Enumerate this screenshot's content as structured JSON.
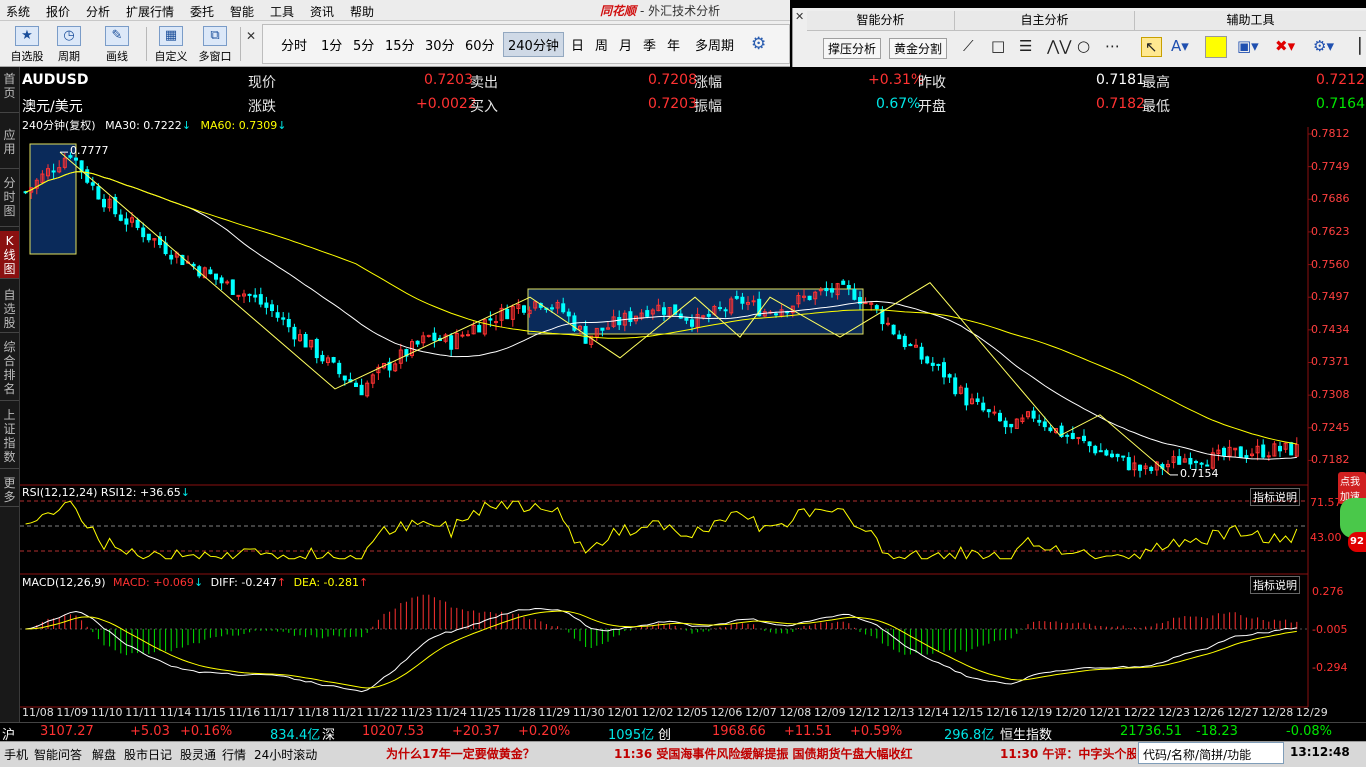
{
  "menu": [
    "系统",
    "报价",
    "分析",
    "扩展行情",
    "委托",
    "智能",
    "工具",
    "资讯",
    "帮助"
  ],
  "app_title": "同花顺",
  "app_subtitle": "- 外汇技术分析",
  "toolbar": [
    {
      "label": "自选股",
      "icon": "star-icon"
    },
    {
      "label": "周期",
      "icon": "clock-icon"
    },
    {
      "label": "画线",
      "icon": "pencil-icon"
    },
    {
      "label": "自定义",
      "icon": "grid-icon"
    },
    {
      "label": "多窗口",
      "icon": "windows-icon"
    }
  ],
  "periods": [
    "分时",
    "1分",
    "5分",
    "15分",
    "30分",
    "60分",
    "240分钟",
    "日",
    "周",
    "月",
    "季",
    "年",
    "多周期"
  ],
  "active_period": "240分钟",
  "tool_panel": {
    "headers": [
      "智能分析",
      "自主分析",
      "辅助工具"
    ],
    "buttons": [
      "撑压分析",
      "黄金分割"
    ]
  },
  "left_nav": [
    "首页",
    "应用",
    "分时图",
    "K线图",
    "自选股",
    "综合排名",
    "上证指数",
    "更多"
  ],
  "quote": {
    "symbol": "AUDUSD",
    "name": "澳元/美元",
    "row1": [
      {
        "label": "现价",
        "value": "0.7203",
        "color": "red"
      },
      {
        "label": "卖出",
        "value": "0.7208",
        "color": "red"
      },
      {
        "label": "涨幅",
        "value": "+0.31%",
        "color": "red"
      },
      {
        "label": "昨收",
        "value": "0.7181",
        "color": "white"
      },
      {
        "label": "最高",
        "value": "0.7212",
        "color": "red"
      }
    ],
    "row2": [
      {
        "label": "涨跌",
        "value": "+0.0022",
        "color": "red"
      },
      {
        "label": "买入",
        "value": "0.7203",
        "color": "red"
      },
      {
        "label": "振幅",
        "value": "0.67%",
        "color": "cyan"
      },
      {
        "label": "开盘",
        "value": "0.7182",
        "color": "red"
      },
      {
        "label": "最低",
        "value": "0.7164",
        "color": "green"
      }
    ]
  },
  "main_legend": {
    "period": "240分钟(复权)",
    "ma30": "MA30: 0.7222",
    "ma60": "MA60: 0.7309"
  },
  "rsi_legend": "RSI(12,12,24)  RSI12: +36.65",
  "macd_legend": {
    "name": "MACD(12,26,9)",
    "macd": "MACD: +0.069",
    "diff": "DIFF: -0.247",
    "dea": "DEA: -0.281"
  },
  "indicator_help": "指标说明",
  "click_badge": "点我加速",
  "badge_number": "92",
  "chart_data": {
    "type": "candlestick",
    "price_axis": [
      "0.7812",
      "0.7749",
      "0.7686",
      "0.7623",
      "0.7560",
      "0.7497",
      "0.7434",
      "0.7371",
      "0.7308",
      "0.7245",
      "0.7182"
    ],
    "ylim": [
      0.715,
      0.7812
    ],
    "annotations": [
      {
        "text": "0.7777",
        "value": 0.7777
      },
      {
        "text": "0.7154",
        "value": 0.7154
      }
    ],
    "rsi_axis": [
      "71.57",
      "43.00"
    ],
    "macd_axis": [
      "0.276",
      "-0.005",
      "-0.294"
    ],
    "dates": [
      "11/08",
      "11/09",
      "11/10",
      "11/11",
      "11/14",
      "11/15",
      "11/16",
      "11/17",
      "11/18",
      "11/21",
      "11/22",
      "11/23",
      "11/24",
      "11/25",
      "11/28",
      "11/29",
      "11/30",
      "12/01",
      "12/02",
      "12/05",
      "12/06",
      "12/07",
      "12/08",
      "12/09",
      "12/12",
      "12/13",
      "12/14",
      "12/15",
      "12/16",
      "12/19",
      "12/20",
      "12/21",
      "12/22",
      "12/23",
      "12/26",
      "12/27",
      "12/28",
      "12/29"
    ],
    "close_path": [
      0.77,
      0.774,
      0.7777,
      0.771,
      0.766,
      0.763,
      0.76,
      0.757,
      0.7545,
      0.752,
      0.75,
      0.747,
      0.743,
      0.739,
      0.735,
      0.732,
      0.736,
      0.739,
      0.742,
      0.741,
      0.744,
      0.746,
      0.748,
      0.749,
      0.747,
      0.742,
      0.744,
      0.746,
      0.748,
      0.747,
      0.745,
      0.747,
      0.749,
      0.747,
      0.748,
      0.75,
      0.751,
      0.7505,
      0.747,
      0.742,
      0.738,
      0.735,
      0.73,
      0.727,
      0.724,
      0.727,
      0.724,
      0.722,
      0.72,
      0.718,
      0.716,
      0.7175,
      0.719,
      0.7185,
      0.7195,
      0.72,
      0.7203
    ]
  },
  "status": {
    "sh": {
      "label": "沪",
      "value": "3107.27",
      "chg": "+5.03",
      "pct": "+0.16%",
      "amount": "834.4亿"
    },
    "sz": {
      "label": "深",
      "value": "10207.53",
      "chg": "+20.37",
      "pct": "+0.20%",
      "amount": "1095亿"
    },
    "cy": {
      "label": "创",
      "value": "1968.66",
      "chg": "+11.51",
      "pct": "+0.59%",
      "amount": "296.8亿"
    },
    "hs": {
      "label": "恒生指数",
      "value": "21736.51",
      "chg": "-18.23",
      "pct": "-0.08%"
    }
  },
  "taskbar": [
    "手机",
    "智能问答",
    "解盘",
    "股市日记",
    "股灵通",
    "行情",
    "24小时滚动"
  ],
  "news": [
    "为什么17年一定要做黄金？",
    "11:36 受国海事件风险缓解提振 国债期货午盘大幅收红",
    "11:30 午评：中字头个股"
  ],
  "code_placeholder": "代码/名称/简拼/功能",
  "clock": "13:12:48"
}
